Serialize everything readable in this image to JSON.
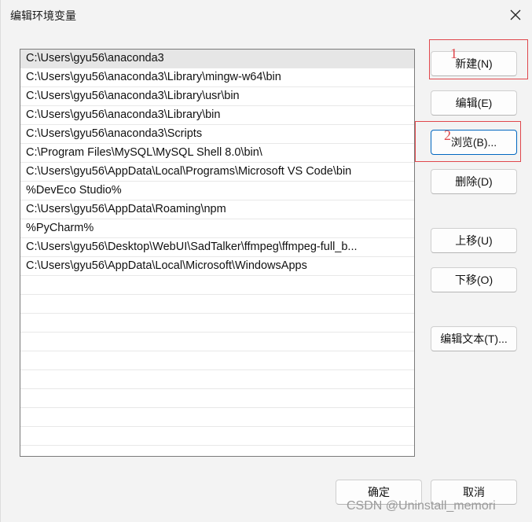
{
  "window": {
    "title": "编辑环境变量"
  },
  "paths": [
    "C:\\Users\\gyu56\\anaconda3",
    "C:\\Users\\gyu56\\anaconda3\\Library\\mingw-w64\\bin",
    "C:\\Users\\gyu56\\anaconda3\\Library\\usr\\bin",
    "C:\\Users\\gyu56\\anaconda3\\Library\\bin",
    "C:\\Users\\gyu56\\anaconda3\\Scripts",
    "C:\\Program Files\\MySQL\\MySQL Shell 8.0\\bin\\",
    "C:\\Users\\gyu56\\AppData\\Local\\Programs\\Microsoft VS Code\\bin",
    "%DevEco Studio%",
    "C:\\Users\\gyu56\\AppData\\Roaming\\npm",
    "%PyCharm%",
    "C:\\Users\\gyu56\\Desktop\\WebUI\\SadTalker\\ffmpeg\\ffmpeg-full_b...",
    "C:\\Users\\gyu56\\AppData\\Local\\Microsoft\\WindowsApps"
  ],
  "buttons": {
    "new": "新建(N)",
    "edit": "编辑(E)",
    "browse": "浏览(B)...",
    "delete": "删除(D)",
    "move_up": "上移(U)",
    "move_down": "下移(O)",
    "edit_text": "编辑文本(T)...",
    "ok": "确定",
    "cancel": "取消"
  },
  "annotations": {
    "first": "1",
    "second": "2"
  },
  "watermark": "CSDN @Uninstall_memori",
  "colors": {
    "annotation": "#e0474c",
    "focus": "#0067c0"
  }
}
